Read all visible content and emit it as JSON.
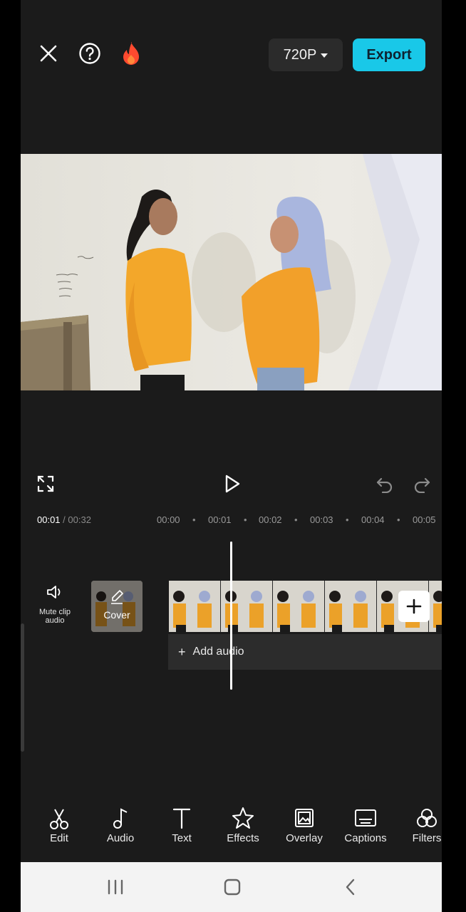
{
  "topbar": {
    "resolution": "720P",
    "export_label": "Export"
  },
  "timeline": {
    "current_time": "00:01",
    "separator": " / ",
    "total_time": "00:32",
    "ticks": [
      "00:00",
      "00:01",
      "00:02",
      "00:03",
      "00:04",
      "00:05"
    ],
    "mute_label": "Mute clip audio",
    "cover_label": "Cover",
    "add_audio_label": "Add audio"
  },
  "toolbar": {
    "items": [
      {
        "label": "Edit",
        "icon": "scissors-icon"
      },
      {
        "label": "Audio",
        "icon": "music-note-icon"
      },
      {
        "label": "Text",
        "icon": "text-icon"
      },
      {
        "label": "Effects",
        "icon": "star-icon"
      },
      {
        "label": "Overlay",
        "icon": "overlay-icon"
      },
      {
        "label": "Captions",
        "icon": "captions-icon"
      },
      {
        "label": "Filters",
        "icon": "filters-icon"
      }
    ]
  },
  "colors": {
    "accent": "#19c8e8",
    "background": "#1b1b1b",
    "flame": "#ff4a2f"
  }
}
